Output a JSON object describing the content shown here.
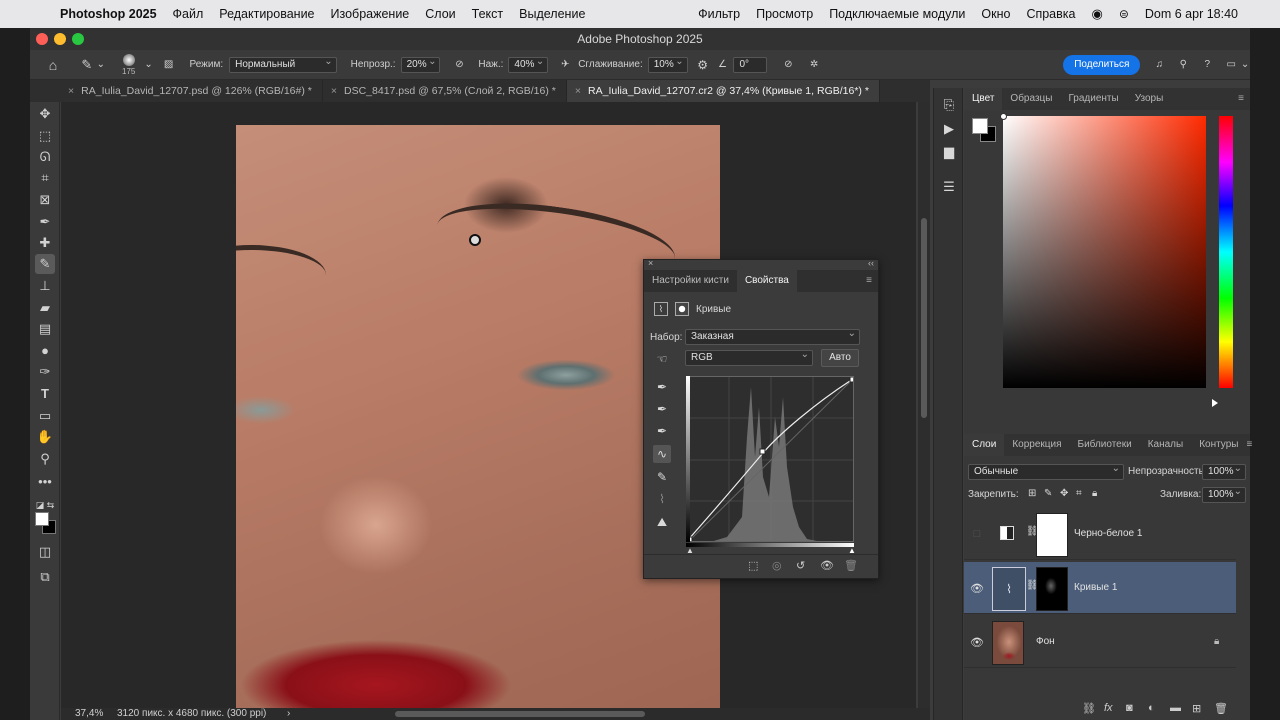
{
  "menubar": {
    "app": "Photoshop 2025",
    "items": [
      "Файл",
      "Редактирование",
      "Изображение",
      "Слои",
      "Текст",
      "Выделение",
      "Фильтр",
      "Просмотр",
      "Подключаемые модули",
      "Окно",
      "Справка"
    ],
    "clock": "Dom 6 apr  18:40"
  },
  "window": {
    "title": "Adobe Photoshop 2025"
  },
  "options": {
    "brush_size": "175",
    "mode_label": "Режим:",
    "mode_value": "Нормальный",
    "opacity_label": "Непрозр.:",
    "opacity_value": "20%",
    "pressure_label": "Наж.:",
    "pressure_value": "40%",
    "smoothing_label": "Сглаживание:",
    "smoothing_value": "10%",
    "angle_value": "0°",
    "share_label": "Поделиться"
  },
  "tabs": [
    {
      "label": "RA_Iulia_David_12707.psd @ 126% (RGB/16#) *"
    },
    {
      "label": "DSC_8417.psd @ 67,5% (Слой 2, RGB/16) *"
    },
    {
      "label": "RA_Iulia_David_12707.cr2 @ 37,4% (Кривые 1, RGB/16*) *"
    }
  ],
  "status": {
    "zoom": "37,4%",
    "info": "3120 пикс. x 4680 пикс. (300 ppi)"
  },
  "color_panel": {
    "tabs": [
      "Цвет",
      "Образцы",
      "Градиенты",
      "Узоры"
    ]
  },
  "layers_panel": {
    "tabs": [
      "Слои",
      "Коррекция",
      "Библиотеки",
      "Каналы",
      "Контуры"
    ],
    "blend": "Обычные",
    "opacity_label": "Непрозрачность:",
    "opacity_value": "100%",
    "lock_label": "Закрепить:",
    "fill_label": "Заливка:",
    "fill_value": "100%",
    "layers": [
      {
        "name": "Черно-белое 1",
        "visible": false
      },
      {
        "name": "Кривые 1",
        "visible": true
      },
      {
        "name": "Фон",
        "visible": true
      }
    ]
  },
  "properties_panel": {
    "tabs": [
      "Настройки кисти",
      "Свойства"
    ],
    "adjustment": "Кривые",
    "preset_label": "Набор:",
    "preset_value": "Заказная",
    "channel_value": "RGB",
    "auto_label": "Авто"
  },
  "colors": {
    "accent": "#1473e6",
    "selected_layer": "#4b5d78"
  }
}
